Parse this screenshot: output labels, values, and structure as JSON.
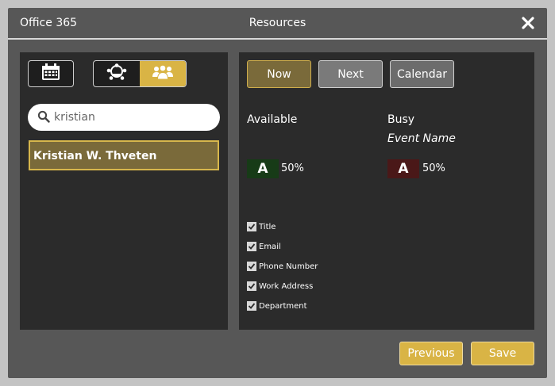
{
  "window": {
    "app_name": "Office 365",
    "title": "Resources",
    "close_icon": "close-icon"
  },
  "left_panel": {
    "calendar_button_icon": "calendar-icon",
    "toggle": {
      "room_icon": "room-icon",
      "people_icon": "people-icon",
      "selected": "people"
    },
    "search": {
      "icon": "search-icon",
      "value": "kristian",
      "placeholder": ""
    },
    "results": [
      {
        "name": "Kristian W. Thveten",
        "selected": true
      }
    ]
  },
  "right_panel": {
    "modes": [
      {
        "label": "Now",
        "active": true
      },
      {
        "label": "Next",
        "active": false
      },
      {
        "label": "Calendar",
        "active": false
      }
    ],
    "available": {
      "label": "Available",
      "swatch_letter": "A",
      "percent": "50%",
      "color": "#173b17"
    },
    "busy": {
      "label": "Busy",
      "event_label": "Event Name",
      "swatch_letter": "A",
      "percent": "50%",
      "color": "#4a1818"
    },
    "fields": [
      {
        "label": "Title",
        "checked": true
      },
      {
        "label": "Email",
        "checked": true
      },
      {
        "label": "Phone Number",
        "checked": true
      },
      {
        "label": "Work Address",
        "checked": true
      },
      {
        "label": "Department",
        "checked": true
      }
    ]
  },
  "footer": {
    "previous_label": "Previous",
    "save_label": "Save"
  },
  "colors": {
    "accent": "#d9b445",
    "panel": "#2b2b2b",
    "window": "#575757"
  }
}
